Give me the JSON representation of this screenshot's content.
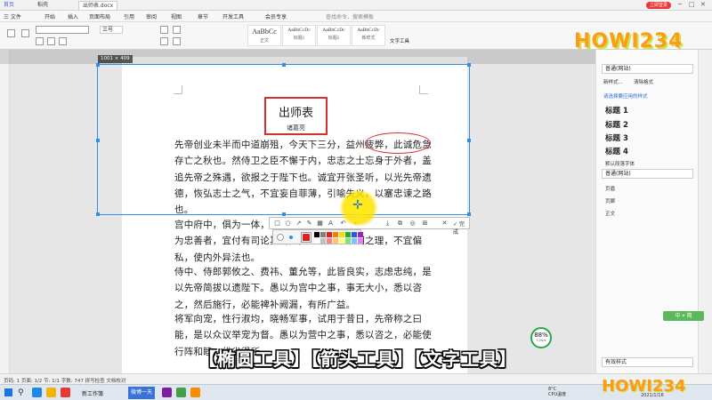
{
  "titlebar": {
    "tabs": [
      {
        "label": "首页"
      },
      {
        "label": "稻壳"
      },
      {
        "label": "出师表.docx"
      }
    ],
    "login_label": "立即登录",
    "window_controls": [
      "─",
      "□",
      "✕"
    ]
  },
  "menubar": {
    "items": [
      "三 文件",
      "开始",
      "插入",
      "页面布局",
      "引用",
      "审阅",
      "视图",
      "章节",
      "开发工具",
      "会员专享"
    ],
    "search_label": "查找命令、搜索模板"
  },
  "ribbon": {
    "font_size": "三号",
    "styles": [
      {
        "sample": "AaBbCc",
        "name": "正文"
      },
      {
        "sample": "AaBbCcDc",
        "name": "标题1"
      },
      {
        "sample": "AaBbCcDc",
        "name": "标题2"
      },
      {
        "sample": "AaBbCcDc",
        "name": "新样式"
      }
    ],
    "text_tool": "文字工具"
  },
  "logo": "HOWI234",
  "document": {
    "title": "出师表",
    "author": "诸葛亮",
    "paragraphs": [
      "先帝创业未半而中道崩殂，今天下三分，益州疲弊，此诚危急存亡之秋也。然侍卫之臣不懈于内，忠志之士忘身于外者，盖追先帝之殊遇，欲报之于陛下也。诚宜开张圣听，以光先帝遗德，恢弘志士之气，不宜妄自菲薄，引喻失义，以塞忠谏之路也。",
      "宫中府中，俱为一体，陟罚臧否，不宜异同。若有作奸犯科及为忠善者，宜付有司论其刑赏，以昭陛下平明之理，不宜偏私，使内外异法也。",
      "侍中、侍郎郭攸之、费祎、董允等，此皆良实，志虑忠纯，是以先帝简拔以遗陛下。愚以为宫中之事，事无大小，悉以咨之，然后施行，必能裨补阙漏，有所广益。",
      "将军向宠，性行淑均，晓畅军事，试用于昔日，先帝称之曰能，是以众议举宠为督。愚以为营中之事，悉以咨之，必能使行阵和睦，优劣得所。"
    ]
  },
  "capture": {
    "size_label": "1001 × 409",
    "finish_label": "✓ 完成",
    "tools": [
      "rect-icon",
      "ellipse-icon",
      "arrow-icon",
      "pen-icon",
      "mosaic-icon",
      "text-icon",
      "undo-icon",
      "pin-icon",
      "save-icon",
      "copy-icon",
      "cancel-icon"
    ],
    "colors": [
      "#000000",
      "#808080",
      "#e02020",
      "#f08000",
      "#f0e000",
      "#20b020",
      "#2060e0",
      "#a020c0",
      "#ffffff",
      "#c0c0c0",
      "#ff8080",
      "#ffc080",
      "#ffff80",
      "#80e080",
      "#80c0ff",
      "#e080ff"
    ],
    "selected_color": "#e02020"
  },
  "style_pane": {
    "current_style": "普通(网站)",
    "new_style": "新样式...",
    "clear_format": "清除格式",
    "hint": "请选择要应用的样式",
    "entries": [
      "标题 1",
      "标题 2",
      "标题 3",
      "标题 4"
    ],
    "small_entries": [
      "默认段落字体",
      "普通(网站)",
      "页眉",
      "页脚",
      "正文"
    ],
    "show_select": "有效样式",
    "cn_badge": "中 ⌖ 简"
  },
  "perf": {
    "value": "88%",
    "speed": "1.2K/s"
  },
  "caption": "【椭圆工具】【箭头工具】【文字工具】",
  "statusbar": {
    "text": "页码: 1  页面: 1/2  节: 1/1  字数: 747  拼写检查  文档校对"
  },
  "taskbar": {
    "search_icon": "⚲",
    "label": "新工作簿",
    "active": "微博一天",
    "temp": "8°C",
    "weather": "CPU温度",
    "date": "2021/1/16"
  }
}
